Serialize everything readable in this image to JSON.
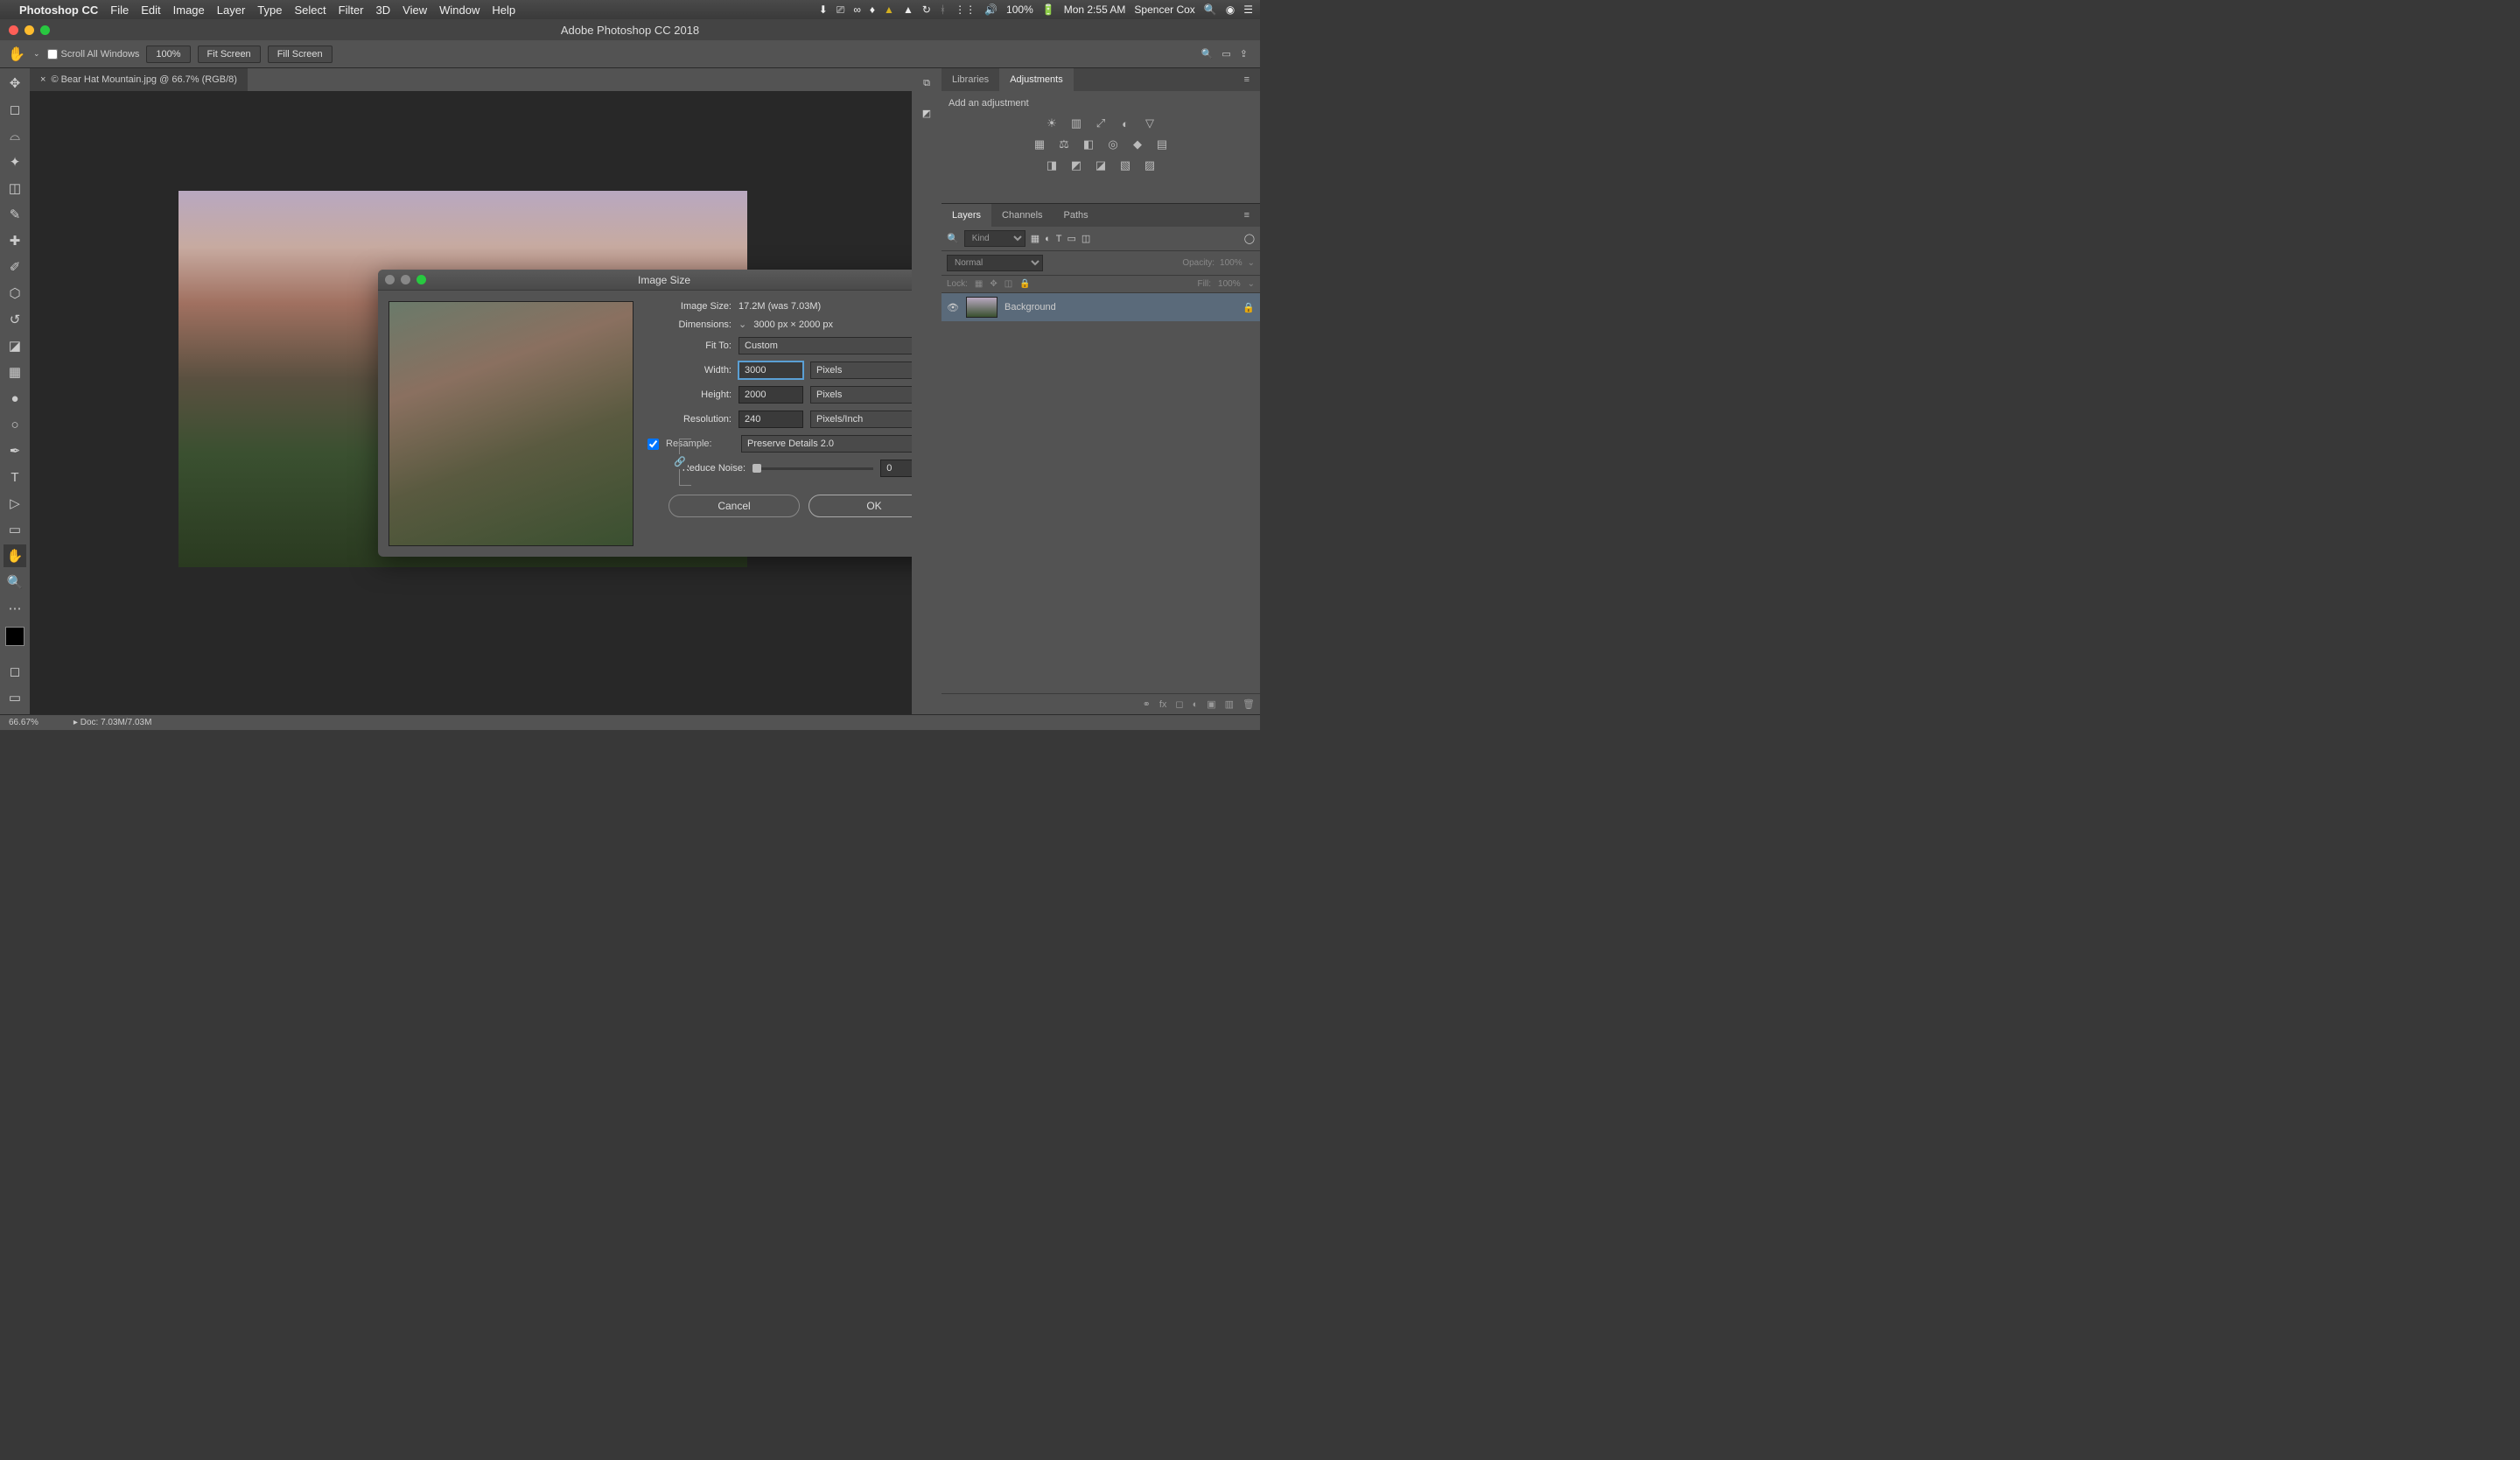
{
  "menubar": {
    "app": "Photoshop CC",
    "items": [
      "File",
      "Edit",
      "Image",
      "Layer",
      "Type",
      "Select",
      "Filter",
      "3D",
      "View",
      "Window",
      "Help"
    ],
    "battery": "100%",
    "clock": "Mon 2:55 AM",
    "user": "Spencer Cox"
  },
  "titlebar": {
    "title": "Adobe Photoshop CC 2018"
  },
  "optbar": {
    "scroll_all": "Scroll All Windows",
    "zoom": "100%",
    "fit": "Fit Screen",
    "fill": "Fill Screen"
  },
  "doc_tab": {
    "name": "© Bear Hat Mountain.jpg @ 66.7% (RGB/8)",
    "close": "×"
  },
  "dialog": {
    "title": "Image Size",
    "image_size_lbl": "Image Size:",
    "image_size_val": "17.2M (was 7.03M)",
    "dimensions_lbl": "Dimensions:",
    "dimensions_val": "3000 px  ×  2000 px",
    "fit_to_lbl": "Fit To:",
    "fit_to_val": "Custom",
    "width_lbl": "Width:",
    "width_val": "3000",
    "width_unit": "Pixels",
    "height_lbl": "Height:",
    "height_val": "2000",
    "height_unit": "Pixels",
    "resolution_lbl": "Resolution:",
    "resolution_val": "240",
    "resolution_unit": "Pixels/Inch",
    "resample_lbl": "Resample:",
    "resample_val": "Preserve Details 2.0",
    "reduce_noise_lbl": "Reduce Noise:",
    "reduce_noise_val": "0",
    "reduce_noise_unit": "%",
    "cancel": "Cancel",
    "ok": "OK"
  },
  "panels": {
    "libraries": "Libraries",
    "adjustments": "Adjustments",
    "add_adj": "Add an adjustment",
    "layers": "Layers",
    "channels": "Channels",
    "paths": "Paths",
    "filter_kind": "Kind",
    "blend": "Normal",
    "opacity_lbl": "Opacity:",
    "opacity_val": "100%",
    "lock_lbl": "Lock:",
    "fill_lbl": "Fill:",
    "fill_val": "100%",
    "layer_name": "Background"
  },
  "statusbar": {
    "zoom": "66.67%",
    "doc": "Doc: 7.03M/7.03M"
  }
}
